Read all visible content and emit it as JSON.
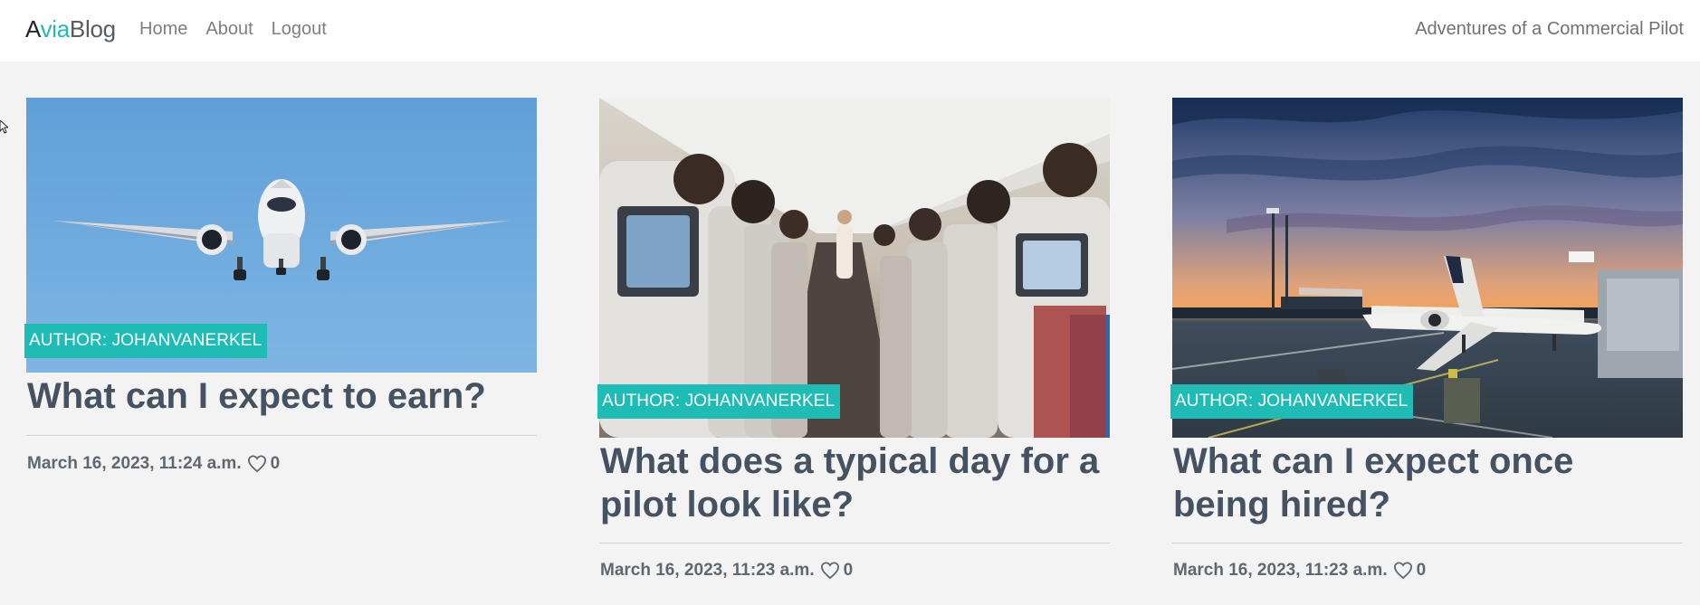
{
  "navbar": {
    "brand_parts": [
      "A",
      "via",
      "Blog"
    ],
    "links": [
      "Home",
      "About",
      "Logout"
    ],
    "tagline": "Adventures of a Commercial Pilot"
  },
  "posts": [
    {
      "image": "airplane-landing-blue-sky",
      "author": "AUTHOR: JOHANVANERKEL",
      "title": "What can I expect to earn?",
      "date": "March 16, 2023, 11:24 a.m.",
      "likes": "0"
    },
    {
      "image": "airplane-cabin-aisle",
      "author": "AUTHOR: JOHANVANERKEL",
      "title": "What does a typical day for a pilot look like?",
      "date": "March 16, 2023, 11:23 a.m.",
      "likes": "0"
    },
    {
      "image": "airport-apron-sunset",
      "author": "AUTHOR: JOHANVANERKEL",
      "title": "What can I expect once being hired?",
      "date": "March 16, 2023, 11:23 a.m.",
      "likes": "0"
    }
  ],
  "colors": {
    "accent": "#1fbbb5",
    "text": "#445261",
    "background": "#f3f3f3"
  },
  "icons": {
    "likes": "heart-outline-icon",
    "cursor": "mouse-pointer-icon"
  }
}
